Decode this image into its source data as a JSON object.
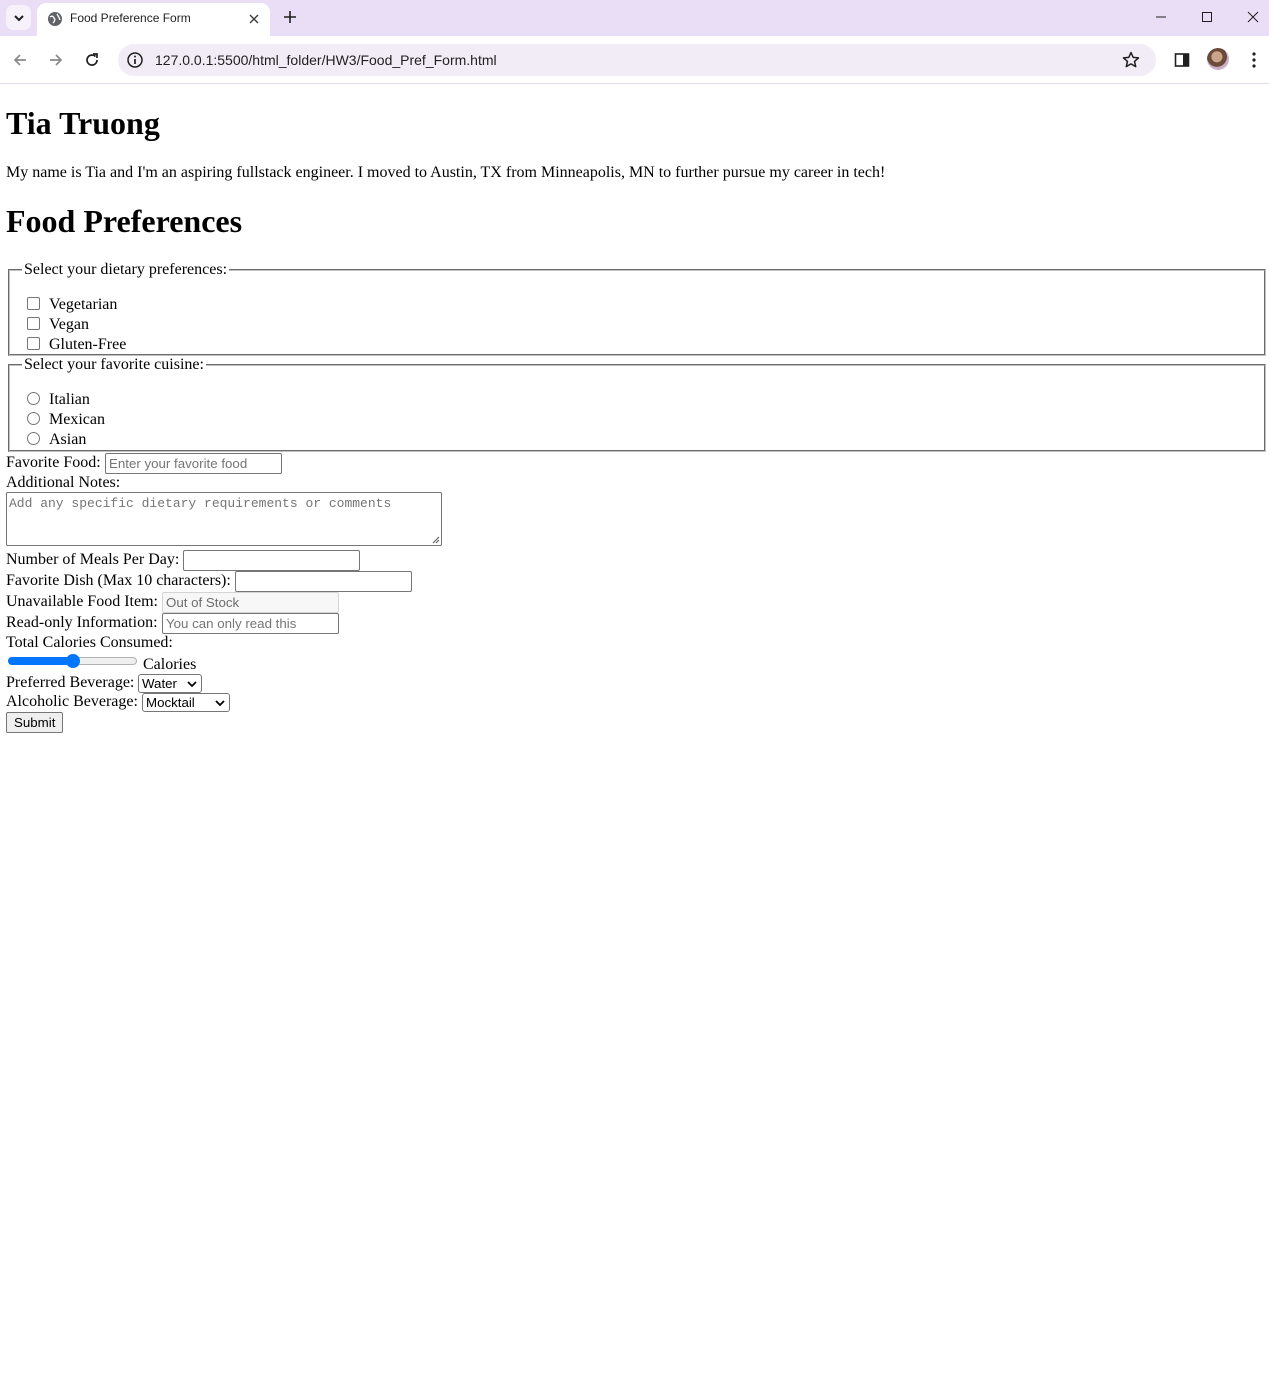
{
  "browser": {
    "tab_title": "Food Preference Form",
    "url": "127.0.0.1:5500/html_folder/HW3/Food_Pref_Form.html"
  },
  "page": {
    "name_heading": "Tia Truong",
    "bio": "My name is Tia and I'm an aspiring fullstack engineer. I moved to Austin, TX from Minneapolis, MN to further pursue my career in tech!",
    "section_heading": "Food Preferences"
  },
  "form": {
    "dietary": {
      "legend": "Select your dietary preferences:",
      "options": [
        "Vegetarian",
        "Vegan",
        "Gluten-Free"
      ]
    },
    "cuisine": {
      "legend": "Select your favorite cuisine:",
      "options": [
        "Italian",
        "Mexican",
        "Asian"
      ]
    },
    "favorite_food": {
      "label": "Favorite Food:",
      "placeholder": "Enter your favorite food"
    },
    "notes": {
      "label": "Additional Notes:",
      "placeholder": "Add any specific dietary requirements or comments"
    },
    "meals": {
      "label": "Number of Meals Per Day:",
      "value": ""
    },
    "dish": {
      "label": "Favorite Dish (Max 10 characters):",
      "value": ""
    },
    "unavailable": {
      "label": "Unavailable Food Item:",
      "value": "Out of Stock"
    },
    "readonly": {
      "label": "Read-only Information:",
      "value": "You can only read this"
    },
    "calories": {
      "label": "Total Calories Consumed:",
      "unit": "Calories",
      "level_fraction": 0.5
    },
    "beverage": {
      "label": "Preferred Beverage:",
      "selected": "Water"
    },
    "alcoholic": {
      "label": "Alcoholic Beverage:",
      "selected": "Mocktail"
    },
    "submit_label": "Submit"
  },
  "colors": {
    "accent": "#0075ff",
    "tabstrip": "#e9def5"
  }
}
